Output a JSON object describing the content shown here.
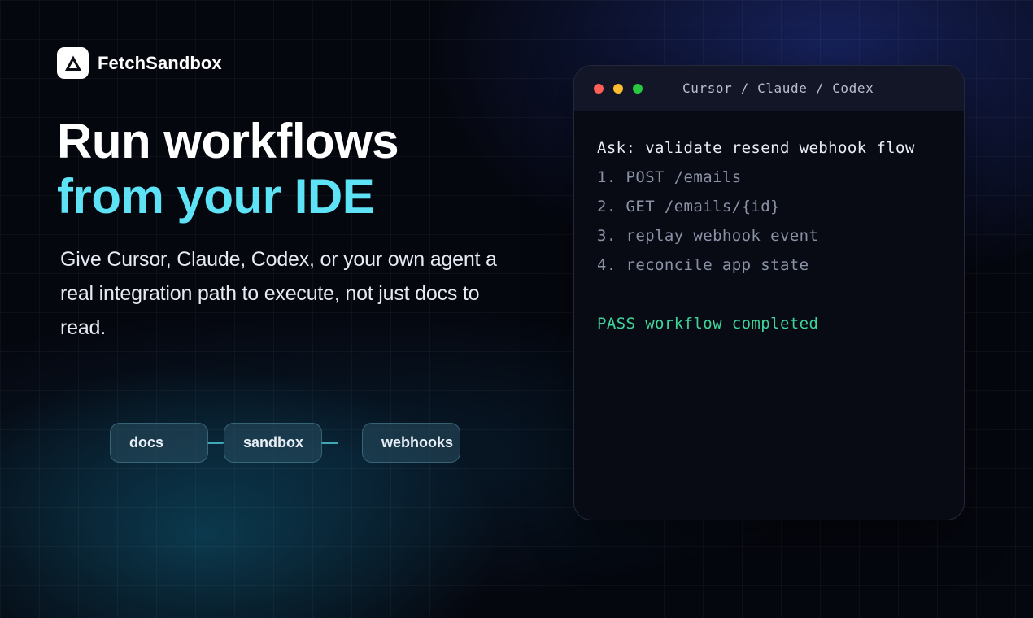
{
  "brand": {
    "name": "FetchSandbox"
  },
  "hero": {
    "title_line1": "Run workflows",
    "title_line2": "from your IDE",
    "description": "Give Cursor, Claude, Codex, or your own agent a real integration path to execute, not just docs to read."
  },
  "flow": {
    "steps": [
      "docs",
      "sandbox",
      "webhooks"
    ]
  },
  "terminal": {
    "title": "Cursor / Claude / Codex",
    "ask": "Ask: validate resend webhook flow",
    "steps": [
      "1. POST /emails",
      "2. GET /emails/{id}",
      "3. replay webhook event",
      "4. reconcile app state"
    ],
    "result": "PASS workflow completed"
  },
  "colors": {
    "accent_cyan": "#5ee3f6",
    "pass_green": "#3fd49a",
    "dot_red": "#ff5f57",
    "dot_yellow": "#febc2e",
    "dot_green": "#28c840"
  },
  "icons": {
    "brand_logo": "triangle-logo-icon"
  }
}
